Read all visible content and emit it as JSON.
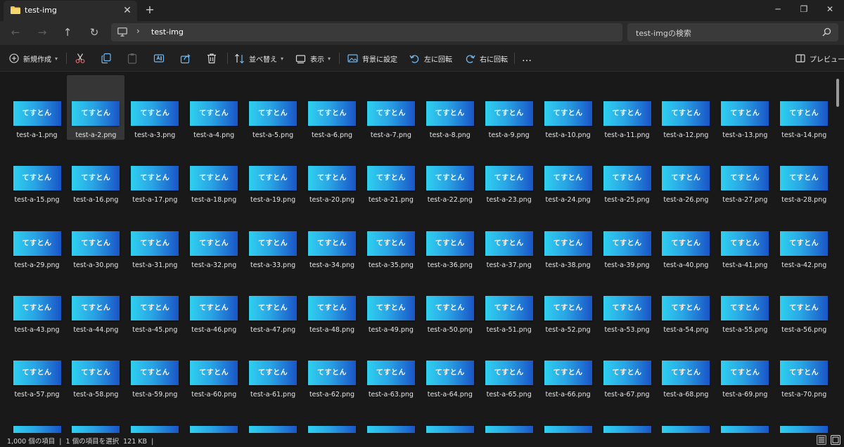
{
  "window": {
    "tab_title": "test-img",
    "tab_close": "✕",
    "new_tab": "+",
    "minimize": "─",
    "maximize": "❐",
    "close": "✕"
  },
  "nav": {
    "back": "←",
    "forward": "→",
    "up": "↑",
    "refresh": "↻",
    "breadcrumb_chevron": "›",
    "path": "test-img",
    "search_placeholder": "test-imgの検索"
  },
  "commands": {
    "new": "新規作成",
    "sort": "並べ替え",
    "view": "表示",
    "set_background": "背景に設定",
    "rotate_left": "左に回転",
    "rotate_right": "右に回転",
    "more": "…",
    "preview": "プレビュー"
  },
  "files": {
    "thumbnail_text": "てすとん",
    "items": [
      "test-a-1.png",
      "test-a-2.png",
      "test-a-3.png",
      "test-a-4.png",
      "test-a-5.png",
      "test-a-6.png",
      "test-a-7.png",
      "test-a-8.png",
      "test-a-9.png",
      "test-a-10.png",
      "test-a-11.png",
      "test-a-12.png",
      "test-a-13.png",
      "test-a-14.png",
      "test-a-15.png",
      "test-a-16.png",
      "test-a-17.png",
      "test-a-18.png",
      "test-a-19.png",
      "test-a-20.png",
      "test-a-21.png",
      "test-a-22.png",
      "test-a-23.png",
      "test-a-24.png",
      "test-a-25.png",
      "test-a-26.png",
      "test-a-27.png",
      "test-a-28.png",
      "test-a-29.png",
      "test-a-30.png",
      "test-a-31.png",
      "test-a-32.png",
      "test-a-33.png",
      "test-a-34.png",
      "test-a-35.png",
      "test-a-36.png",
      "test-a-37.png",
      "test-a-38.png",
      "test-a-39.png",
      "test-a-40.png",
      "test-a-41.png",
      "test-a-42.png",
      "test-a-43.png",
      "test-a-44.png",
      "test-a-45.png",
      "test-a-46.png",
      "test-a-47.png",
      "test-a-48.png",
      "test-a-49.png",
      "test-a-50.png",
      "test-a-51.png",
      "test-a-52.png",
      "test-a-53.png",
      "test-a-54.png",
      "test-a-55.png",
      "test-a-56.png",
      "test-a-57.png",
      "test-a-58.png",
      "test-a-59.png",
      "test-a-60.png",
      "test-a-61.png",
      "test-a-62.png",
      "test-a-63.png",
      "test-a-64.png",
      "test-a-65.png",
      "test-a-66.png",
      "test-a-67.png",
      "test-a-68.png",
      "test-a-69.png",
      "test-a-70.png"
    ],
    "selected_item": "test-a-2.png"
  },
  "status": {
    "item_count": "1,000 個の項目",
    "separator": "|",
    "selection": "1 個の項目を選択  121 KB",
    "trailing_separator": "|"
  },
  "colors": {
    "background": "#191919",
    "toolbar": "#202020",
    "addressbar": "#2b2b2b",
    "selection": "#363636",
    "thumb_gradient_start": "#2fd0f0",
    "thumb_gradient_end": "#1a55c7",
    "folder": "#f3c24b"
  },
  "icons": {
    "tab": "folder-icon",
    "address": "computer-icon",
    "search": "search-icon",
    "commands": [
      "plus-circle-icon",
      "cut-icon",
      "copy-icon",
      "paste-icon",
      "rename-icon",
      "share-icon",
      "delete-icon",
      "sort-icon",
      "view-icon",
      "wallpaper-icon",
      "rotate-left-icon",
      "rotate-right-icon",
      "more-icon",
      "preview-pane-icon"
    ],
    "status": [
      "details-view-icon",
      "tiles-view-icon"
    ]
  }
}
